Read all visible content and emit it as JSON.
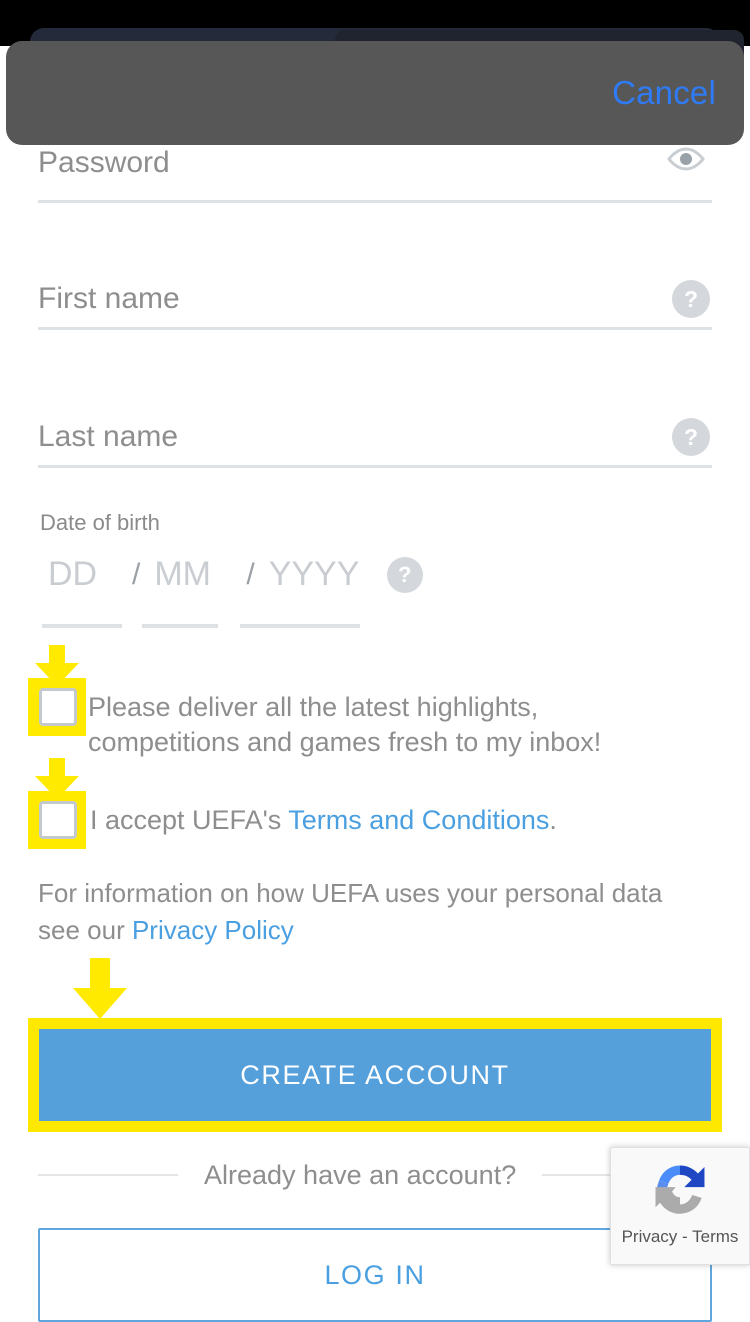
{
  "overlay": {
    "cancel_label": "Cancel"
  },
  "form": {
    "fields": [
      {
        "name": "password",
        "label": "Password",
        "icon": "eye-icon"
      },
      {
        "name": "first_name",
        "label": "First name",
        "icon": "help-icon",
        "icon_char": "?"
      },
      {
        "name": "last_name",
        "label": "Last name",
        "icon": "help-icon",
        "icon_char": "?"
      }
    ],
    "dob": {
      "label": "Date of birth",
      "day_placeholder": "DD",
      "month_placeholder": "MM",
      "year_placeholder": "YYYY",
      "separator": "/",
      "help_char": "?"
    },
    "checkboxes": [
      {
        "name": "marketing-optin",
        "line1": "Please deliver all the latest highlights,",
        "line2": "competitions and games fresh to my inbox!",
        "checked": false
      },
      {
        "name": "terms-accept",
        "prefix": "I accept UEFA's ",
        "link": "Terms and Conditions",
        "suffix": ".",
        "checked": false
      }
    ],
    "privacy": {
      "text_before": "For information on how UEFA uses your personal data see our ",
      "link": "Privacy Policy"
    },
    "create_account_label": "CREATE ACCOUNT",
    "divider_text": "Already have an account?",
    "login_label": "LOG IN"
  },
  "recaptcha": {
    "privacy_label": "Privacy",
    "separator": " - ",
    "terms_label": "Terms"
  },
  "colors": {
    "accent_blue": "#4a9fe0",
    "button_blue": "#55a0db",
    "cancel_blue": "#2f7bf5",
    "annotation_yellow": "#ffea00",
    "overlay_gray": "#575757",
    "text_gray": "#8e8e8e"
  }
}
